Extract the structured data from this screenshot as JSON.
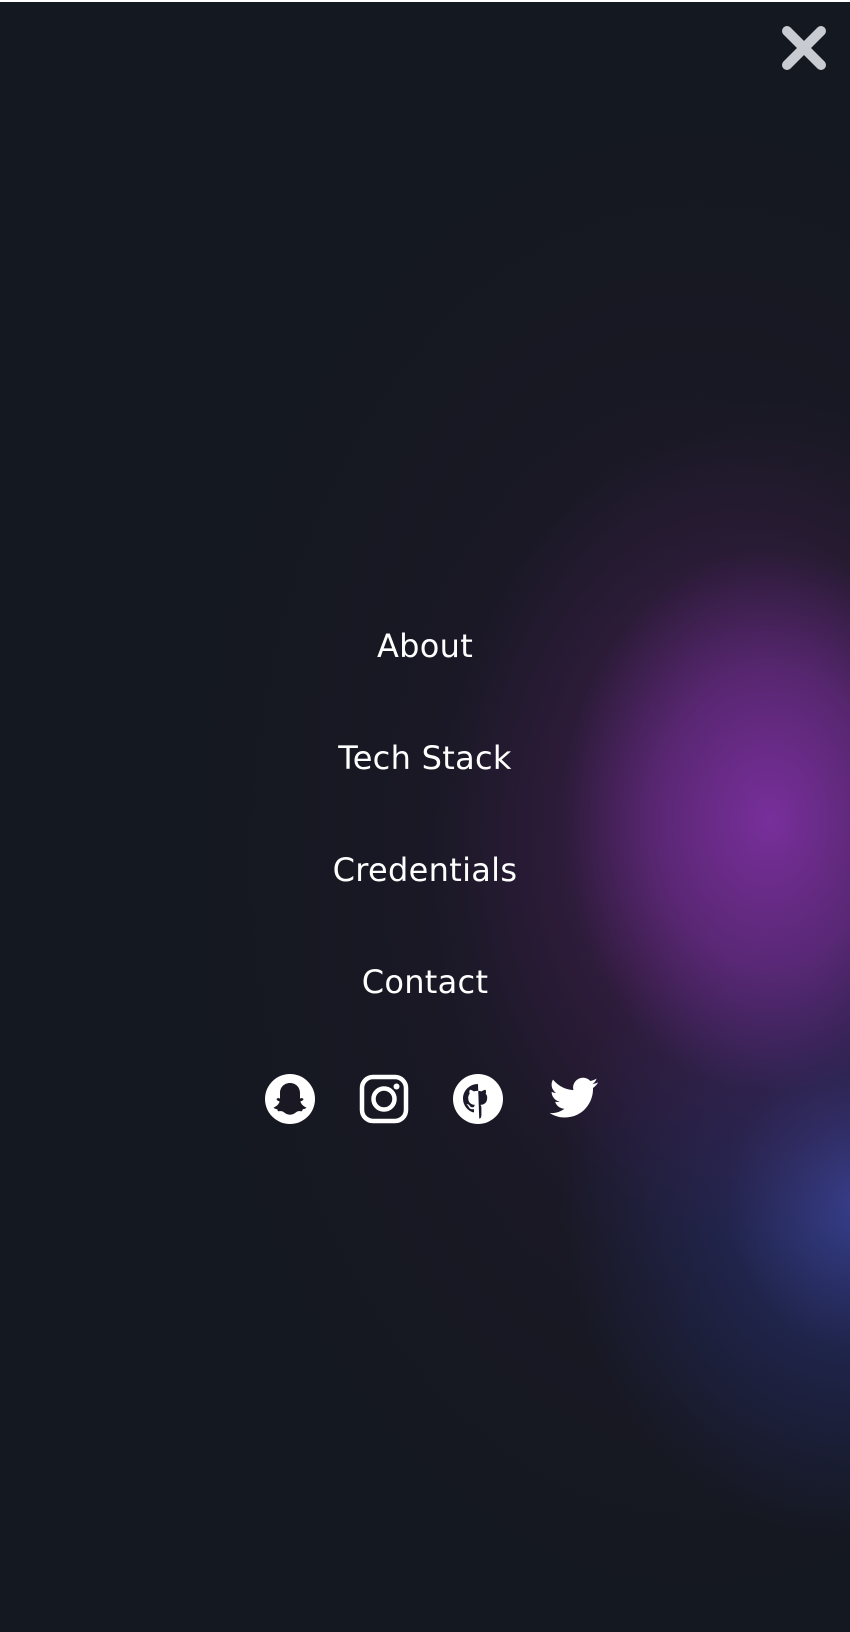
{
  "menu": {
    "close_icon": "close-icon",
    "items": [
      {
        "label": "About"
      },
      {
        "label": "Tech Stack"
      },
      {
        "label": "Credentials"
      },
      {
        "label": "Contact"
      }
    ]
  },
  "social": [
    {
      "icon": "snapchat-icon"
    },
    {
      "icon": "instagram-icon"
    },
    {
      "icon": "github-icon"
    },
    {
      "icon": "twitter-icon"
    }
  ],
  "colors": {
    "background": "#141820",
    "glow_purple": "#7c30a0",
    "glow_blue": "#3c46a0",
    "text": "#ffffff",
    "close_icon": "#c8ccd2"
  }
}
